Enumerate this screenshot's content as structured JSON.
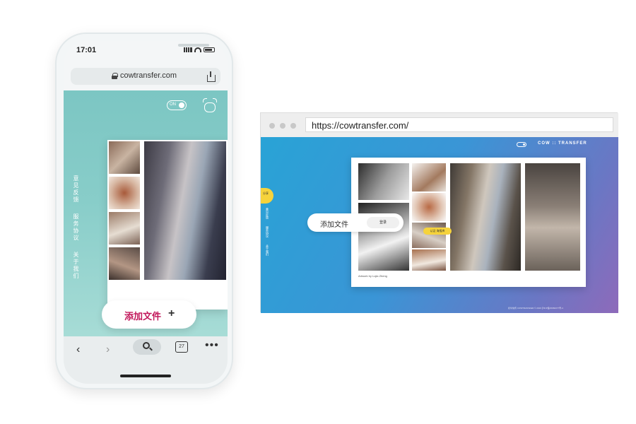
{
  "phone": {
    "time": "17:01",
    "url": "cowtransfer.com",
    "toggle_label": "ON",
    "side_links": [
      "意见反馈",
      "服务协议",
      "关于我们"
    ],
    "add_file_label": "添加文件",
    "add_file_plus": "+",
    "tab_count": "27",
    "nav_back": "‹",
    "nav_forward": "›",
    "more": "•••"
  },
  "browser": {
    "url": "https://cowtransfer.com/",
    "logo": "COW :: TRANSFER",
    "add_file_label": "添加文件",
    "login_label": "登录",
    "credit": "Artwork by Lujia Zheng",
    "tag_label": "认证 海报库",
    "yellow_tab": "分享",
    "side_links": [
      "意见反馈",
      "服务协议",
      "关于我们"
    ],
    "footer": "奶牛快传 COWTRANSFER © 2019 沪ICP备15060377号-4"
  },
  "colors": {
    "phone_bg": "#88cdc9",
    "browser_gradient_start": "#29a3d6",
    "browser_gradient_end": "#8e6aba",
    "accent_yellow": "#f6d33c",
    "add_label_red": "#c2185b"
  }
}
